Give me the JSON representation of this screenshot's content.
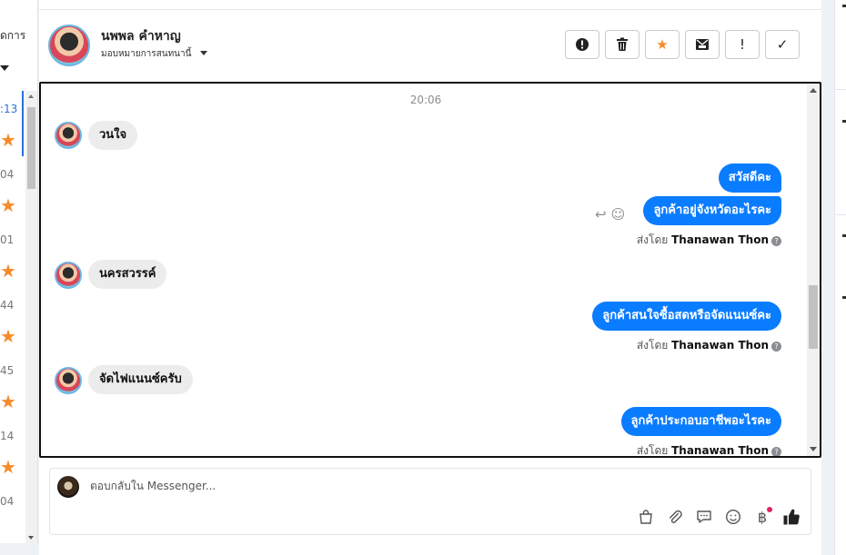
{
  "left_panel": {
    "header_label": "ดการ",
    "items": [
      {
        "time": ":13",
        "active": true
      },
      {
        "star": "★"
      },
      {
        "time": "04"
      },
      {
        "star": "★"
      },
      {
        "time": "01"
      },
      {
        "star": "★"
      },
      {
        "time": "44"
      },
      {
        "star": "★"
      },
      {
        "time": "45"
      },
      {
        "star": "★"
      },
      {
        "time": "14"
      },
      {
        "star": "★"
      },
      {
        "time": "04"
      }
    ]
  },
  "header": {
    "name": "นพพล คำหาญ",
    "subtitle": "มอบหมายการสนทนานี้",
    "actions": [
      {
        "name": "alert-icon",
        "label": "!"
      },
      {
        "name": "trash-icon",
        "label": ""
      },
      {
        "name": "star-icon",
        "label": "★"
      },
      {
        "name": "mark-unread-icon",
        "label": ""
      },
      {
        "name": "exclamation-icon",
        "label": "!"
      },
      {
        "name": "check-icon",
        "label": "✓"
      }
    ]
  },
  "chat": {
    "timestamp": "20:06",
    "messages": [
      {
        "dir": "in",
        "text": "วนใจ"
      },
      {
        "dir": "out",
        "text": "สวัสดีคะ"
      },
      {
        "dir": "out",
        "text": "ลูกค้าอยู่จังหวัดอะไรคะ"
      },
      {
        "dir": "out",
        "text": "ลูกค้าสนใจซื้อสดหรือจัดแนนซ์คะ"
      },
      {
        "dir": "in",
        "text": "นครสวรรค์"
      },
      {
        "dir": "in",
        "text": "จัดไฟแนนซ์ครับ"
      },
      {
        "dir": "out",
        "text": "ลูกค้าประกอบอาชีพอะไรคะ"
      }
    ],
    "sent_by_prefix": "ส่งโดย",
    "sent_by_name": "Thanawan Thon"
  },
  "composer": {
    "placeholder": "ตอบกลับใน Messenger..."
  },
  "colors": {
    "accent": "#0a7cff",
    "star": "#f58b2a",
    "incoming_bubble": "#ececec"
  }
}
